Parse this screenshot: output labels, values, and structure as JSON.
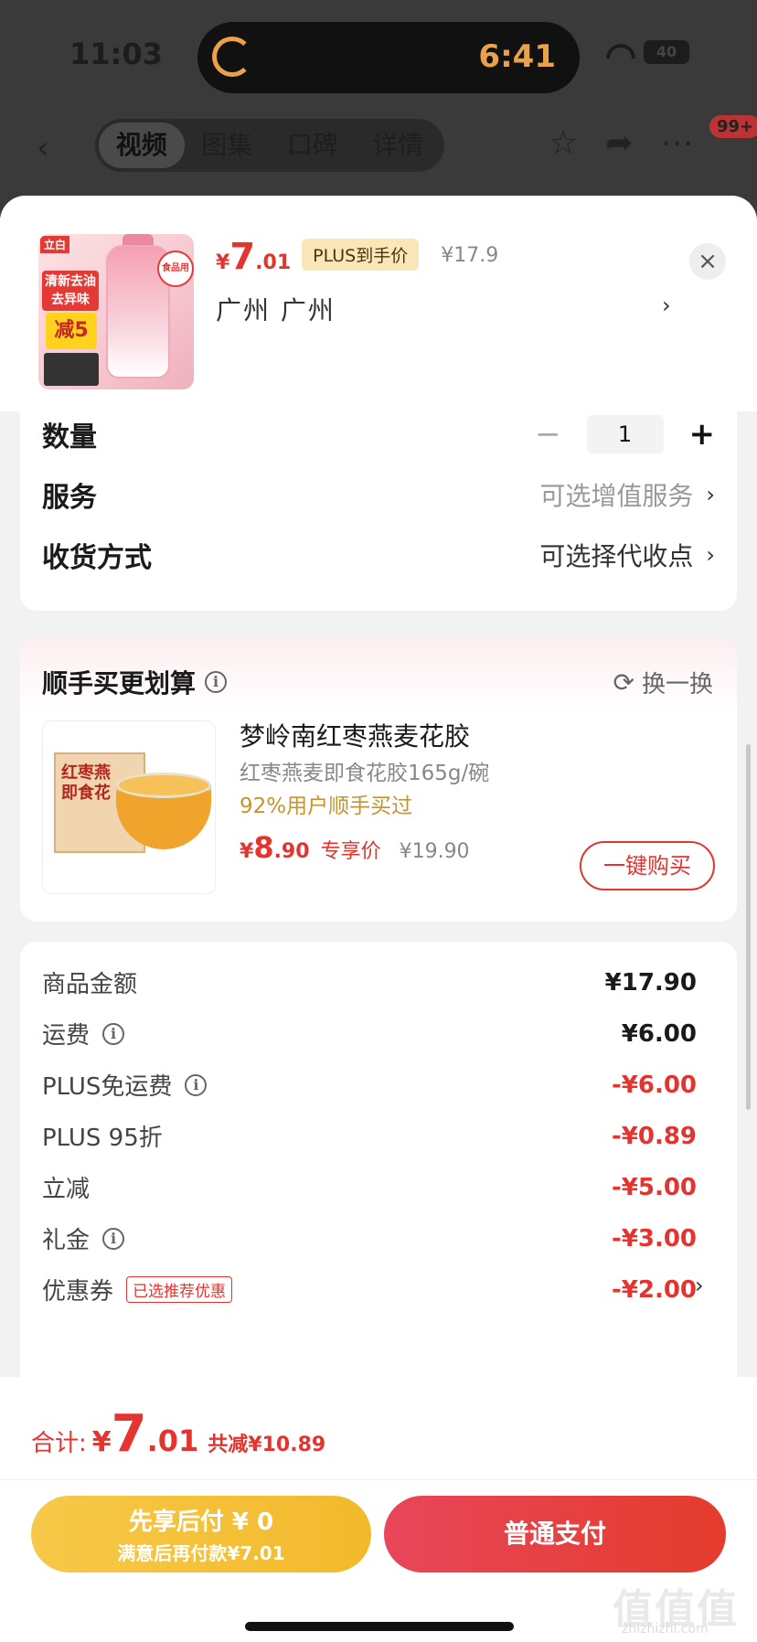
{
  "status_bar": {
    "time": "11:03",
    "timer": "6:41",
    "battery": "40"
  },
  "nav": {
    "back": "‹",
    "tabs": [
      {
        "label": "视频",
        "active": true
      },
      {
        "label": "图集",
        "active": false
      },
      {
        "label": "口碑",
        "active": false
      },
      {
        "label": "详情",
        "active": false
      }
    ],
    "icons": [
      "star-icon",
      "share-icon",
      "more-icon"
    ],
    "badge": "99+"
  },
  "product": {
    "image_text": {
      "brand": "立白",
      "tag1": "清新去油\n去异味",
      "tag2": "减5",
      "round": "食品用"
    },
    "price_symbol": "¥",
    "price_int": "7",
    "price_dec": ".01",
    "plus_tag": "PLUS到手价",
    "original_price": "¥17.9",
    "location": "广州 广州",
    "close": "×"
  },
  "options": {
    "quantity_label": "数量",
    "quantity_value": "1",
    "minus": "−",
    "plus": "+",
    "service_label": "服务",
    "service_value": "可选增值服务",
    "delivery_label": "收货方式",
    "delivery_value": "可选择代收点",
    "chevron": "›"
  },
  "upsell": {
    "title": "顺手买更划算",
    "refresh": "换一换",
    "image_box_text": "红枣燕\n即食花",
    "name": "梦岭南红枣燕麦花胶",
    "spec": "红枣燕麦即食花胶165g/碗",
    "social": "92%用户顺手买过",
    "price_symbol": "¥",
    "price_int": "8",
    "price_dec": ".90",
    "exclusive": "专享价",
    "original": "¥19.90",
    "buy_button": "一键购买"
  },
  "summary": {
    "rows": [
      {
        "label": "商品金额",
        "value": "¥17.90",
        "red": false,
        "info": false
      },
      {
        "label": "运费",
        "value": "¥6.00",
        "red": false,
        "info": true
      },
      {
        "label": "PLUS免运费",
        "value": "-¥6.00",
        "red": true,
        "info": true
      },
      {
        "label": "PLUS 95折",
        "value": "-¥0.89",
        "red": true,
        "info": false
      },
      {
        "label": "立减",
        "value": "-¥5.00",
        "red": true,
        "info": false
      },
      {
        "label": "礼金",
        "value": "-¥3.00",
        "red": true,
        "info": true
      },
      {
        "label": "优惠券",
        "value": "-¥2.00",
        "red": true,
        "info": false
      }
    ],
    "coupon_tag": "已选推荐优惠"
  },
  "footer": {
    "total_label": "合计:",
    "total_symbol": "¥",
    "total_int": "7",
    "total_dec": ".01",
    "total_saved": "共减¥10.89",
    "pay_later_main": "先享后付 ¥ 0",
    "pay_later_sub": "满意后再付款¥7.01",
    "pay_normal": "普通支付"
  },
  "watermark": {
    "main": "值值值",
    "sub": "zhizhizhi.com"
  },
  "colors": {
    "accent_red": "#e3342f",
    "gold": "#f3b92c",
    "plus_tag_bg": "#fbe6b8"
  }
}
